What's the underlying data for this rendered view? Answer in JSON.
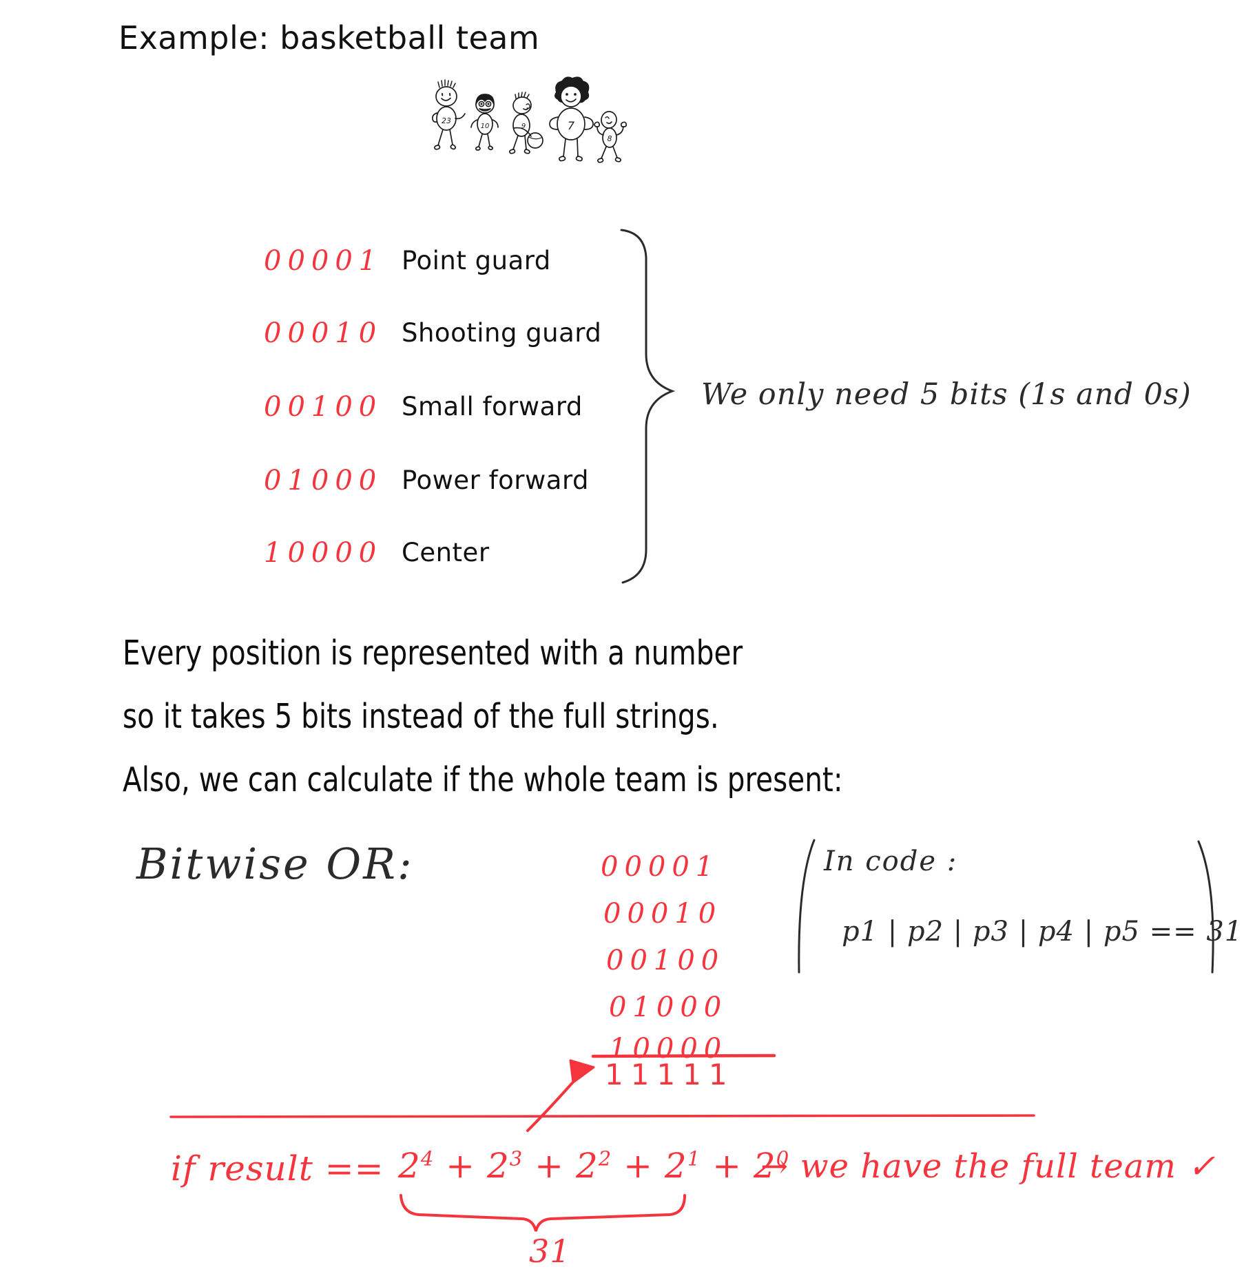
{
  "title": "Example: basketball team",
  "colors": {
    "red": "#f4353d",
    "ink": "#2b2b2b",
    "marker": "#111111",
    "paper": "#ffffff"
  },
  "team": {
    "players": [
      {
        "jersey": "23",
        "hair": "spiky",
        "pose": "waving"
      },
      {
        "jersey": "10",
        "hair": "bowl",
        "pose": "standing"
      },
      {
        "jersey": "9",
        "hair": "short-spiky",
        "pose": "dribbling"
      },
      {
        "jersey": "7",
        "hair": "afro",
        "pose": "hands-on-hips"
      },
      {
        "jersey": "8",
        "hair": "bald",
        "pose": "arms-up"
      }
    ]
  },
  "positions": [
    {
      "code": "00001",
      "label": "Point guard"
    },
    {
      "code": "00010",
      "label": "Shooting guard"
    },
    {
      "code": "00100",
      "label": "Small forward"
    },
    {
      "code": "01000",
      "label": "Power forward"
    },
    {
      "code": "10000",
      "label": "Center"
    }
  ],
  "brace_note": "We only need 5 bits (1s and 0s)",
  "paragraph": [
    "Every position is represented with a number",
    "so it takes 5 bits instead of the full strings.",
    "Also, we can calculate if the whole team is present:"
  ],
  "bitwise": {
    "heading": "Bitwise OR:",
    "operands": [
      "00001",
      "00010",
      "00100",
      "01000",
      "10000"
    ],
    "result": "11111"
  },
  "in_code": {
    "line1": "In code :",
    "line2": "p1 | p2 | p3 | p4 | p5 == 31"
  },
  "conclusion": {
    "if": "if result ==",
    "powers": [
      {
        "base": "2",
        "exp": "4"
      },
      {
        "base": "2",
        "exp": "3"
      },
      {
        "base": "2",
        "exp": "2"
      },
      {
        "base": "2",
        "exp": "1"
      },
      {
        "base": "2",
        "exp": "0"
      }
    ],
    "tail": "→ we have the full team ✓",
    "sum": "31"
  }
}
